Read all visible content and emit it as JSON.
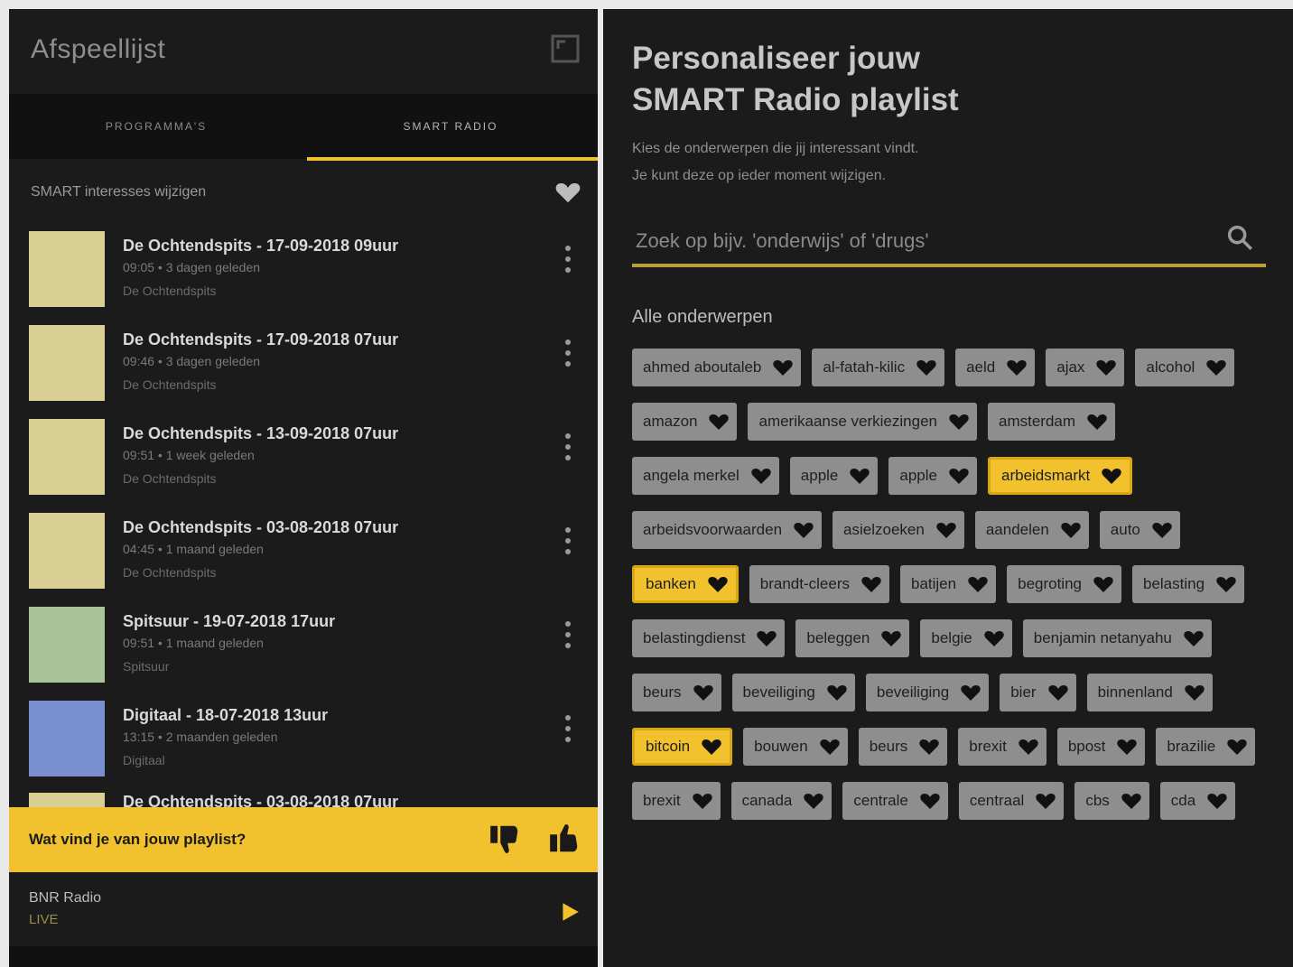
{
  "left_panel": {
    "title": "Afspeellijst",
    "tabs": [
      "PROGRAMMA'S",
      "SMART RADIO"
    ],
    "smart_label": "SMART interesses wijzigen",
    "items": [
      {
        "title": "De Ochtendspits - 17-09-2018 09uur",
        "meta": "09:05 • 3 dagen geleden",
        "source": "De Ochtendspits",
        "thumb_color": "#d9cf94"
      },
      {
        "title": "De Ochtendspits - 17-09-2018 07uur",
        "meta": "09:46 • 3 dagen geleden",
        "source": "De Ochtendspits",
        "thumb_color": "#d9cf94"
      },
      {
        "title": "De Ochtendspits - 13-09-2018 07uur",
        "meta": "09:51 • 1 week geleden",
        "source": "De Ochtendspits",
        "thumb_color": "#d9cf94"
      },
      {
        "title": "De Ochtendspits - 03-08-2018 07uur",
        "meta": "04:45 • 1 maand geleden",
        "source": "De Ochtendspits",
        "thumb_color": "#d9cf94"
      },
      {
        "title": "Spitsuur - 19-07-2018 17uur",
        "meta": "09:51 • 1 maand geleden",
        "source": "Spitsuur",
        "thumb_color": "#a9c49a"
      },
      {
        "title": "Digitaal - 18-07-2018 13uur",
        "meta": "13:15 • 2 maanden geleden",
        "source": "Digitaal",
        "thumb_color": "#7a8fd0"
      }
    ],
    "peek_title": "De Ochtendspits - 03-08-2018 07uur",
    "feedback_text": "Wat vind je van jouw playlist?",
    "station": "BNR Radio",
    "live": "LIVE"
  },
  "right_panel": {
    "title_line1": "Personaliseer jouw",
    "title_line2": "SMART Radio playlist",
    "subtitle_line1": "Kies de onderwerpen die jij interessant vindt.",
    "subtitle_line2": "Je kunt deze op ieder moment wijzigen.",
    "search_placeholder": "Zoek op bijv. 'onderwijs' of 'drugs'",
    "all_label": "Alle onderwerpen",
    "topics": [
      {
        "label": "ahmed aboutaleb",
        "selected": false
      },
      {
        "label": "al-fatah-kilic",
        "selected": false
      },
      {
        "label": "aeld",
        "selected": false
      },
      {
        "label": "ajax",
        "selected": false
      },
      {
        "label": "alcohol",
        "selected": false
      },
      {
        "label": "amazon",
        "selected": false
      },
      {
        "label": "amerikaanse verkiezingen",
        "selected": false
      },
      {
        "label": "amsterdam",
        "selected": false
      },
      {
        "label": "angela merkel",
        "selected": false
      },
      {
        "label": "apple",
        "selected": false
      },
      {
        "label": "apple",
        "selected": false
      },
      {
        "label": "arbeidsmarkt",
        "selected": true
      },
      {
        "label": "arbeidsvoorwaarden",
        "selected": false
      },
      {
        "label": "asielzoeken",
        "selected": false
      },
      {
        "label": "aandelen",
        "selected": false
      },
      {
        "label": "auto",
        "selected": false
      },
      {
        "label": "banken",
        "selected": true
      },
      {
        "label": "brandt-cleers",
        "selected": false
      },
      {
        "label": "batijen",
        "selected": false
      },
      {
        "label": "begroting",
        "selected": false
      },
      {
        "label": "belasting",
        "selected": false
      },
      {
        "label": "belastingdienst",
        "selected": false
      },
      {
        "label": "beleggen",
        "selected": false
      },
      {
        "label": "belgie",
        "selected": false
      },
      {
        "label": "benjamin netanyahu",
        "selected": false
      },
      {
        "label": "beurs",
        "selected": false
      },
      {
        "label": "beveiliging",
        "selected": false
      },
      {
        "label": "beveiliging",
        "selected": false
      },
      {
        "label": "bier",
        "selected": false
      },
      {
        "label": "binnenland",
        "selected": false
      },
      {
        "label": "bitcoin",
        "selected": true
      },
      {
        "label": "bouwen",
        "selected": false
      },
      {
        "label": "beurs",
        "selected": false
      },
      {
        "label": "brexit",
        "selected": false
      },
      {
        "label": "bpost",
        "selected": false
      },
      {
        "label": "brazilie",
        "selected": false
      },
      {
        "label": "brexit",
        "selected": false
      },
      {
        "label": "canada",
        "selected": false
      },
      {
        "label": "centrale",
        "selected": false
      },
      {
        "label": "centraal",
        "selected": false
      },
      {
        "label": "cbs",
        "selected": false
      },
      {
        "label": "cda",
        "selected": false
      }
    ]
  },
  "colors": {
    "accent": "#f2c12e",
    "panel_bg": "#1b1b1b",
    "chip_bg": "#8e8e8e"
  },
  "icons": [
    "expand-icon",
    "heart-icon",
    "more-vert-icon",
    "thumb-down-icon",
    "thumb-up-icon",
    "play-icon",
    "search-icon"
  ]
}
